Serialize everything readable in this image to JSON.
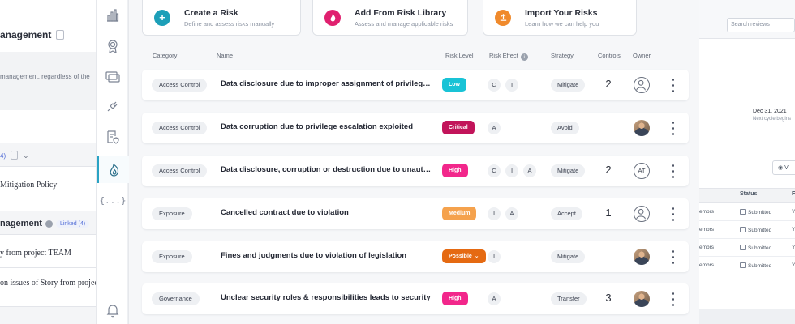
{
  "left_doc": {
    "title": "anagement",
    "desc": "management, regardless of the",
    "linked_count": "4)",
    "policy": "Mitigation Policy",
    "section_title": "nagement",
    "section_linked": "Linked (4)",
    "story1": "y from project  TEAM",
    "story2": "on issues of Story from project"
  },
  "right_panel": {
    "search_placeholder": "Search reviews",
    "date": "Dec 31, 2021",
    "cycle": "Next cycle begins",
    "view_label": "Vi",
    "status_header": "Status",
    "col3_header": "F",
    "rows": [
      {
        "member": "embrs",
        "status": "Submitted",
        "extra": "Y"
      },
      {
        "member": "embrs",
        "status": "Submitted",
        "extra": "Y"
      },
      {
        "member": "embrs",
        "status": "Submitted",
        "extra": "Y"
      },
      {
        "member": "embrs",
        "status": "Submitted",
        "extra": "Y"
      }
    ]
  },
  "sidebar": {
    "items": [
      {
        "icon": "bar-chart-icon"
      },
      {
        "icon": "award-ribbon-icon"
      },
      {
        "icon": "stacked-windows-icon"
      },
      {
        "icon": "plug-icon"
      },
      {
        "icon": "shield-document-icon"
      },
      {
        "icon": "flame-icon",
        "active": true
      },
      {
        "icon": "curly-braces-icon"
      },
      {
        "icon": "bell-icon"
      }
    ],
    "braces_text": "{...}"
  },
  "actions": [
    {
      "title": "Create a Risk",
      "subtitle": "Define and assess risks manually",
      "icon": "plus-icon",
      "color": "#1d9fb8"
    },
    {
      "title": "Add From Risk Library",
      "subtitle": "Assess and manage applicable risks",
      "icon": "flame-icon",
      "color": "#e0206f"
    },
    {
      "title": "Import Your Risks",
      "subtitle": "Learn how we can help you",
      "icon": "upload-icon",
      "color": "#f08a2c"
    }
  ],
  "columns": {
    "category": "Category",
    "name": "Name",
    "risk_level": "Risk Level",
    "risk_effect": "Risk Effect",
    "strategy": "Strategy",
    "controls": "Controls",
    "owner": "Owner"
  },
  "level_colors": {
    "Low": "#19c3d6",
    "Critical": "#c2145a",
    "High": "#f2278b",
    "Medium": "#f5a24d",
    "Possible": "#e56a12"
  },
  "risks": [
    {
      "category": "Access Control",
      "name": "Data disclosure due to improper assignment of privileged...",
      "level": "Low",
      "effects": [
        "C",
        "I"
      ],
      "strategy": "Mitigate",
      "controls": "2",
      "owner": "empty"
    },
    {
      "category": "Access Control",
      "name": "Data corruption due to privilege escalation exploited",
      "level": "Critical",
      "effects": [
        "A"
      ],
      "strategy": "Avoid",
      "controls": "",
      "owner": "photo"
    },
    {
      "category": "Access Control",
      "name": "Data disclosure, corruption or destruction due to unauth...",
      "level": "High",
      "effects": [
        "C",
        "I",
        "A"
      ],
      "strategy": "Mitigate",
      "controls": "2",
      "owner": "AT"
    },
    {
      "category": "Exposure",
      "name": "Cancelled contract due to violation",
      "level": "Medium",
      "effects": [
        "I",
        "A"
      ],
      "strategy": "Accept",
      "controls": "1",
      "owner": "empty"
    },
    {
      "category": "Exposure",
      "name": "Fines and judgments due to violation of legislation",
      "level": "Possible",
      "level_dropdown": "⌄",
      "effects": [
        "I"
      ],
      "strategy": "Mitigate",
      "controls": "",
      "owner": "photo"
    },
    {
      "category": "Governance",
      "name": "Unclear security roles & responsibilities leads to security",
      "level": "High",
      "effects": [
        "A"
      ],
      "strategy": "Transfer",
      "controls": "3",
      "owner": "photo"
    }
  ]
}
